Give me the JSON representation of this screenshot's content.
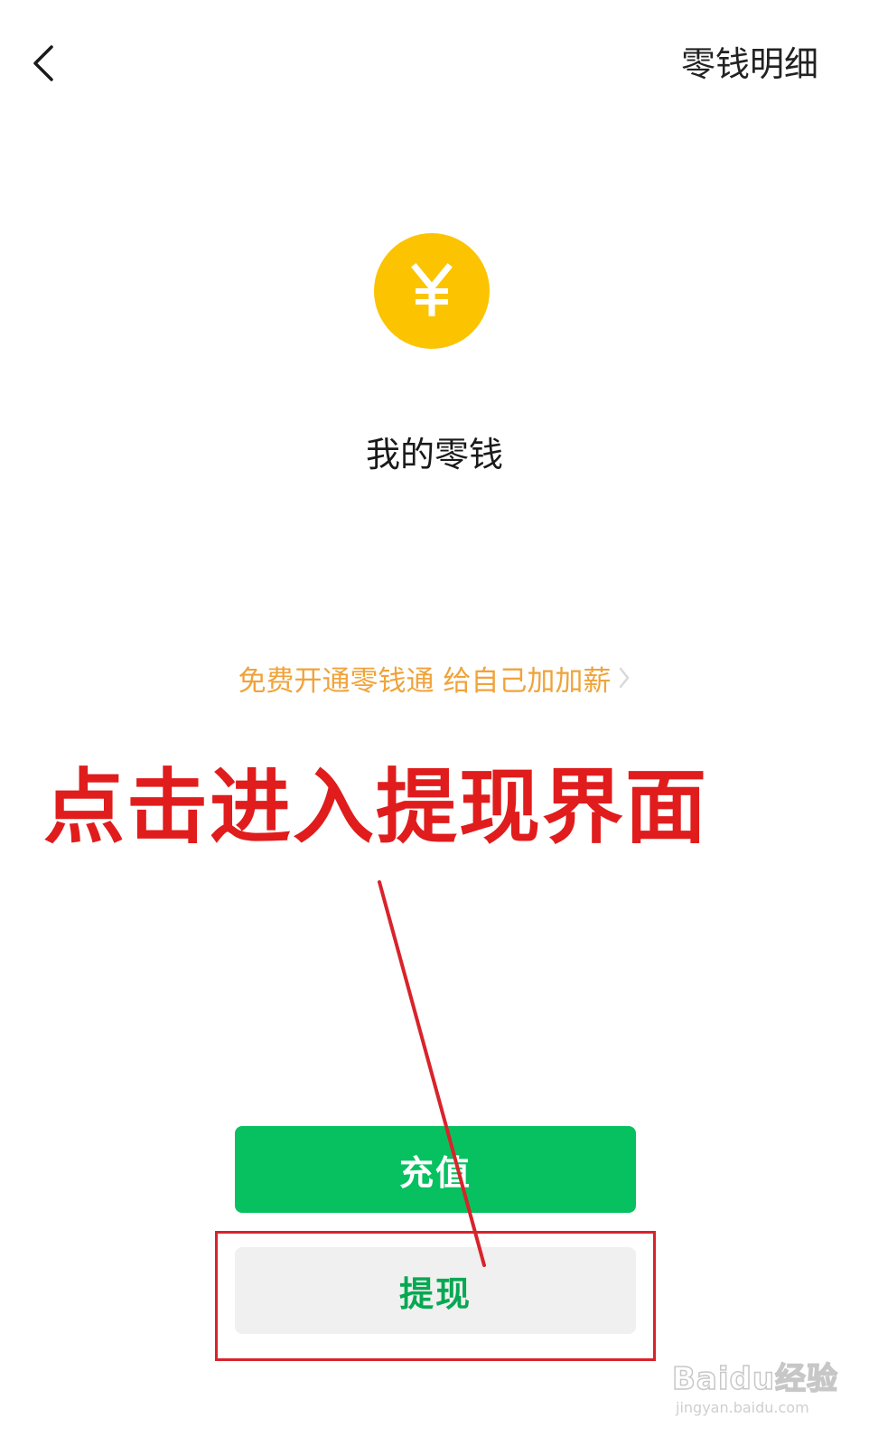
{
  "nav": {
    "back_icon": "chevron-left-icon",
    "detail_label": "零钱明细"
  },
  "wallet": {
    "coin_icon": "yuan-coin-icon",
    "coin_color": "#fcc300",
    "title": "我的零钱"
  },
  "promo": {
    "label": "免费开通零钱通 给自己加加薪",
    "icon": "chevron-right-icon",
    "color": "#f0a33a"
  },
  "annotation": {
    "text": "点击进入提现界面",
    "color": "#e01c1c"
  },
  "actions": {
    "recharge_label": "充值",
    "withdraw_label": "提现",
    "primary_color": "#07c160"
  },
  "watermark": {
    "brand": "Baidu经验",
    "url": "jingyan.baidu.com"
  }
}
